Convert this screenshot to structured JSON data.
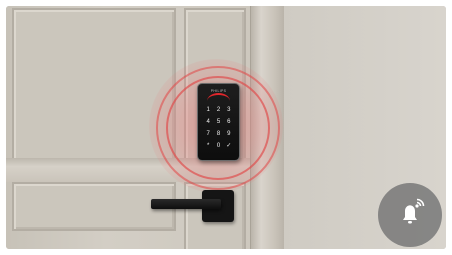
{
  "keypad": {
    "brand": "PHILIPS",
    "keys": [
      "1",
      "2",
      "3",
      "4",
      "5",
      "6",
      "7",
      "8",
      "9",
      "*",
      "0",
      "✓"
    ]
  },
  "doorbell": {
    "icon": "bell-wifi-icon"
  },
  "colors": {
    "accent_red": "#e0262b",
    "keypad_body": "#111111",
    "button_bg": "#7a7a7a"
  }
}
